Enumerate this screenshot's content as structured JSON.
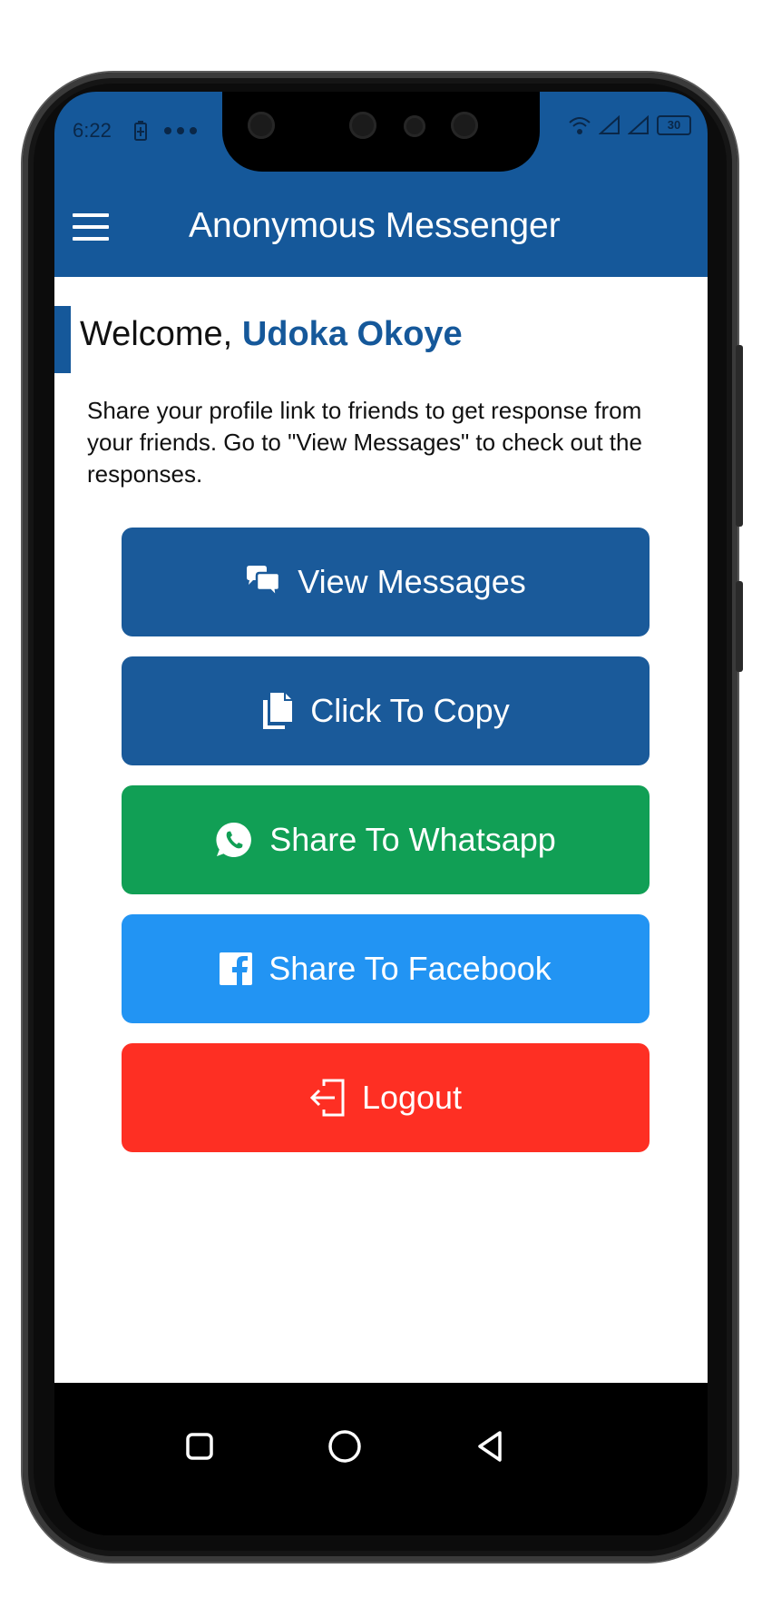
{
  "status_bar": {
    "time": "6:22",
    "battery": "30",
    "icons": [
      "battery-charging-icon",
      "more-dots-icon",
      "wifi-icon",
      "signal-icon",
      "battery-icon"
    ]
  },
  "app_bar": {
    "title": "Anonymous Messenger",
    "menu_icon": "hamburger-menu-icon"
  },
  "welcome": {
    "prefix": "Welcome,",
    "name": "Udoka Okoye"
  },
  "description": "Share your profile link to friends to get response from your friends. Go to \"View Messages\" to check out the responses.",
  "buttons": [
    {
      "label": "View Messages",
      "icon": "chat-bubbles-icon",
      "color": "#1a5a9a"
    },
    {
      "label": "Click To Copy",
      "icon": "copy-icon",
      "color": "#1a5a9a"
    },
    {
      "label": "Share To Whatsapp",
      "icon": "whatsapp-icon",
      "color": "#119f55"
    },
    {
      "label": "Share To Facebook",
      "icon": "facebook-icon",
      "color": "#2294f3"
    },
    {
      "label": "Logout",
      "icon": "logout-icon",
      "color": "#fe2f23"
    }
  ],
  "navigation": {
    "icons": [
      "recent-apps-icon",
      "home-icon",
      "back-icon"
    ]
  },
  "colors": {
    "primary": "#15589a",
    "whatsapp": "#119f55",
    "facebook": "#2294f3",
    "logout": "#fe2f23"
  }
}
